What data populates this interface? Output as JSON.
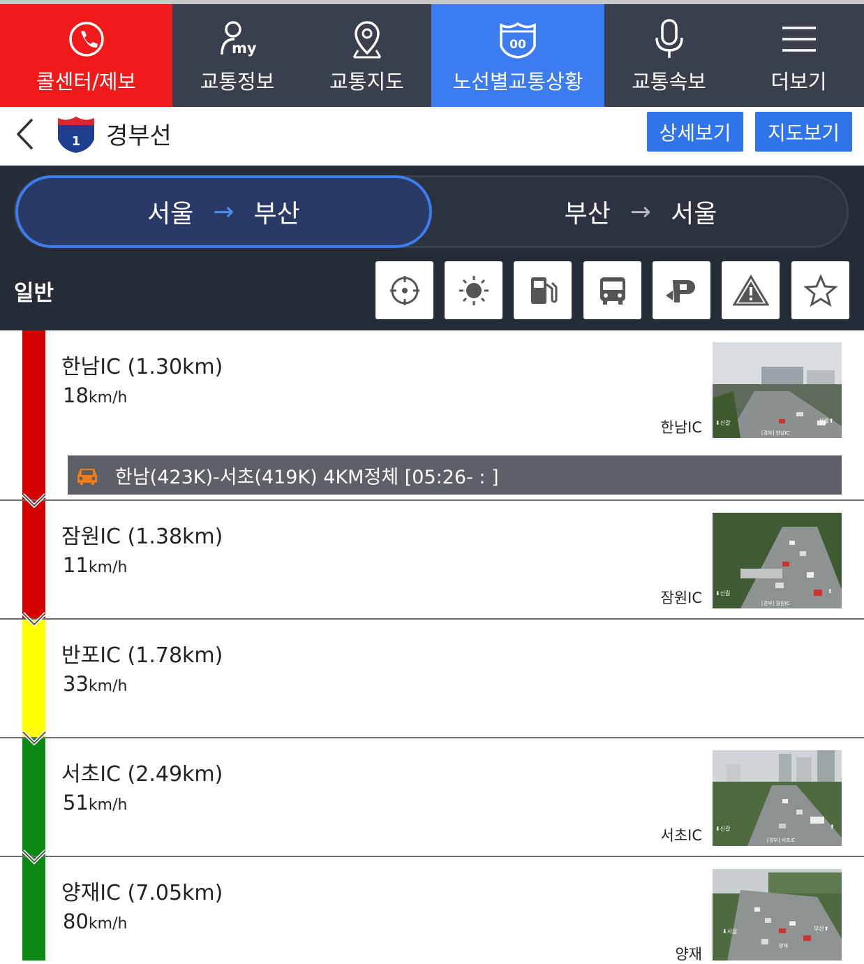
{
  "nav": {
    "items": [
      {
        "label": "콜센터/제보",
        "icon": "phone-icon"
      },
      {
        "label": "교통정보",
        "icon": "my-user-icon"
      },
      {
        "label": "교통지도",
        "icon": "map-pin-icon"
      },
      {
        "label": "노선별교통상황",
        "icon": "route-shield-icon"
      },
      {
        "label": "교통속보",
        "icon": "microphone-icon"
      },
      {
        "label": "더보기",
        "icon": "menu-icon"
      }
    ],
    "shield_text": "00"
  },
  "header": {
    "route_number": "1",
    "route_name": "경부선",
    "detail_button": "상세보기",
    "map_button": "지도보기"
  },
  "direction": {
    "active": {
      "from": "서울",
      "arrow": "→",
      "to": "부산"
    },
    "inactive": {
      "from": "부산",
      "arrow": "→",
      "to": "서울"
    }
  },
  "filter": {
    "label": "일반",
    "tools": [
      "crosshair-icon",
      "weather-sun-icon",
      "gas-station-icon",
      "bus-icon",
      "rest-area-icon",
      "warning-icon",
      "star-icon"
    ]
  },
  "speed_colors": {
    "red": "#d40000",
    "yellow": "#ffff00",
    "green": "#0a8a12"
  },
  "interchanges": [
    {
      "name": "한남IC",
      "distance": "(1.30km)",
      "speed": "18",
      "unit": "km/h",
      "color": "red",
      "cam_label": "한남IC",
      "cam_text": {
        "left": "⬇신갈",
        "right": "서울⬆",
        "bottom": "[경부] 한남IC"
      }
    },
    {
      "name": "잠원IC",
      "distance": "(1.38km)",
      "speed": "11",
      "unit": "km/h",
      "color": "red",
      "cam_label": "잠원IC",
      "cam_text": {
        "left": "⬇신갈",
        "right": "⬆",
        "bottom": "[경부] 잠원IC"
      }
    },
    {
      "name": "반포IC",
      "distance": "(1.78km)",
      "speed": "33",
      "unit": "km/h",
      "color": "yellow",
      "cam_label": ""
    },
    {
      "name": "서초IC",
      "distance": "(2.49km)",
      "speed": "51",
      "unit": "km/h",
      "color": "green",
      "cam_label": "서초IC",
      "cam_text": {
        "left": "⬇신갈",
        "right": "⬆",
        "bottom": "[경부] 서초IC"
      }
    },
    {
      "name": "양재IC",
      "distance": "(7.05km)",
      "speed": "80",
      "unit": "km/h",
      "color": "green",
      "cam_label": "양재",
      "cam_text": {
        "left": "⬇서울",
        "right": "부산⬆",
        "bottom": "양재"
      }
    }
  ],
  "incident": {
    "icon": "car-icon",
    "text": "한남(423K)-서초(419K) 4KM정체 [05:26-  :  ]"
  }
}
